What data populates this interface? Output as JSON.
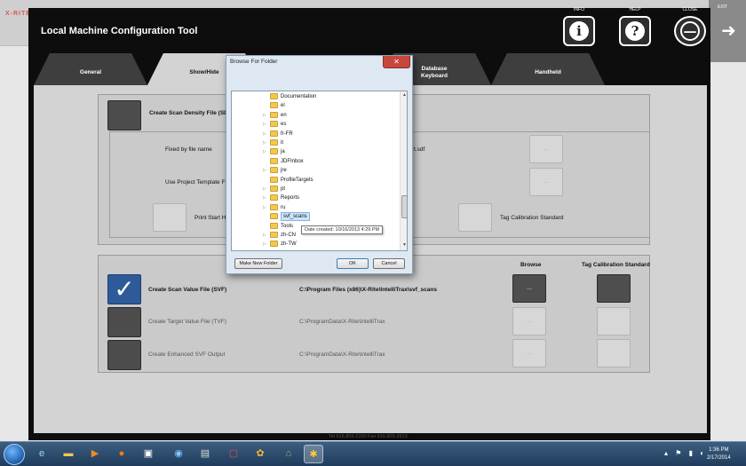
{
  "app": {
    "title": "Local Machine Configuration Tool",
    "top_buttons": [
      {
        "label": "INFO",
        "glyph": "i",
        "icon": "info-icon"
      },
      {
        "label": "HELP",
        "glyph": "?",
        "icon": "help-icon"
      },
      {
        "label": "CLOSE",
        "glyph": "—",
        "icon": "minimize-icon"
      }
    ],
    "behind_exit_label": "EXIT",
    "tabs": [
      "General",
      "Show/Hide",
      "Database\nKeyboard",
      "Handheld"
    ]
  },
  "scan_density": {
    "create_label": "Create Scan Density File (SDF)",
    "fixed_by_name_label": "Fixed by file name",
    "sdf_path_suffix": "t.sdf",
    "use_template_label": "Use Project Template F",
    "print_start_label": "Print Start H",
    "tag_calibration_label": "Tag Calibration Standard",
    "button_label": "..."
  },
  "svf": {
    "headers": {
      "browse": "Browse",
      "tag_calibration": "Tag Calibration Standard"
    },
    "rows": [
      {
        "label": "Create Scan Value File (SVF)",
        "path": "C:\\Program Files (x86)\\X-Rite\\IntelliTrax\\svf_scans",
        "checked": true,
        "browse_label": "...",
        "enabled": true
      },
      {
        "label": "Create Target Value File (TVF)",
        "path": "C:\\ProgramData\\X-Rite\\IntelliTrax",
        "checked": false,
        "browse_label": "...",
        "enabled": false
      },
      {
        "label": "Create Enhanced SVF Output",
        "path": "C:\\ProgramData\\X-Rite\\IntelliTrax",
        "checked": false,
        "browse_label": "...",
        "enabled": false
      }
    ]
  },
  "dialog": {
    "title": "Browse For Folder",
    "close_glyph": "✕",
    "folders": [
      {
        "name": "Documentation",
        "expandable": false
      },
      {
        "name": "el",
        "expandable": false
      },
      {
        "name": "en",
        "expandable": true
      },
      {
        "name": "es",
        "expandable": true
      },
      {
        "name": "fr-FR",
        "expandable": true
      },
      {
        "name": "it",
        "expandable": true
      },
      {
        "name": "ja",
        "expandable": true
      },
      {
        "name": "JDFInbox",
        "expandable": false
      },
      {
        "name": "jre",
        "expandable": true
      },
      {
        "name": "ProfileTargets",
        "expandable": false
      },
      {
        "name": "pt",
        "expandable": true
      },
      {
        "name": "Reports",
        "expandable": true
      },
      {
        "name": "ru",
        "expandable": true
      },
      {
        "name": "svf_scans",
        "expandable": false,
        "selected": true
      },
      {
        "name": "Tools",
        "expandable": false
      },
      {
        "name": "zh-CN",
        "expandable": true
      },
      {
        "name": "zh-TW",
        "expandable": true
      }
    ],
    "tooltip": "Date created: 10/16/2013 4:29 PM",
    "make_new_folder": "Make New Folder",
    "ok": "OK",
    "cancel": "Cancel"
  },
  "footer_text": "Tel 616.803-2100 Fax 616.803-2513",
  "taskbar": {
    "time": "1:36 PM",
    "date": "2/17/2014"
  }
}
